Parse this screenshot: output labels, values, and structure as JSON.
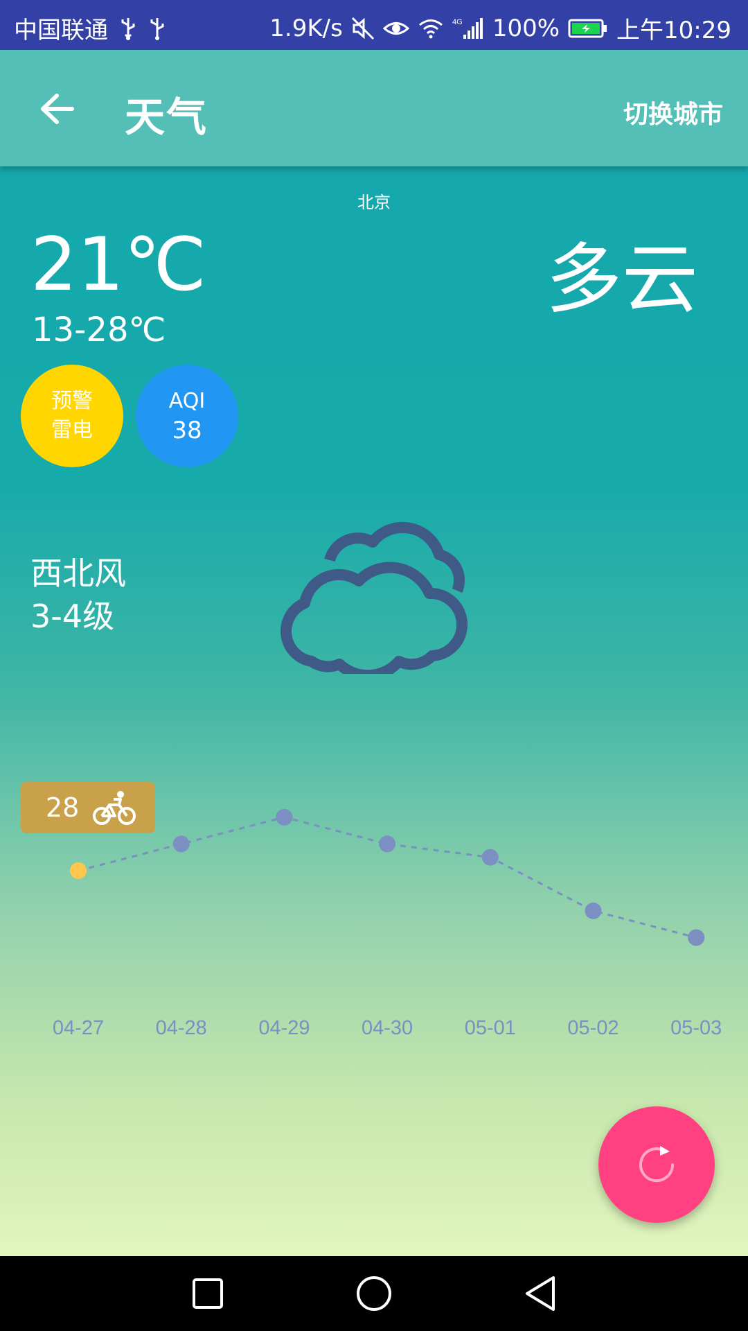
{
  "status_bar": {
    "carrier": "中国联通",
    "net_speed": "1.9K/s",
    "network_type": "4G",
    "battery": "100%",
    "time": "上午10:29",
    "icons": [
      "usb-icon",
      "usb-icon",
      "mute-icon",
      "eye-icon",
      "wifi-icon",
      "signal-icon",
      "battery-icon"
    ]
  },
  "toolbar": {
    "title": "天气",
    "action": "切换城市"
  },
  "weather": {
    "city": "北京",
    "temp_now": "21℃",
    "temp_range": "13-28℃",
    "condition": "多云",
    "warning_label": "预警",
    "warning_type": "雷电",
    "aqi_label": "AQI",
    "aqi_value": "38",
    "wind_direction": "西北风",
    "wind_level": "3-4级",
    "bike_index": "28"
  },
  "colors": {
    "status_bar": "#3340a6",
    "toolbar": "#53bfb6",
    "warning_badge": "#ffd600",
    "aqi_badge": "#2196f3",
    "bike_tag": "#c9a14a",
    "fab": "#ff4081",
    "chart_point": "#7b8fc2",
    "chart_highlight": "#ffc74d",
    "cloud": "#3f5a86"
  },
  "chart_data": {
    "type": "line",
    "categories": [
      "04-27",
      "04-28",
      "04-29",
      "04-30",
      "05-01",
      "05-02",
      "05-03"
    ],
    "series": [
      {
        "values": [
          0.0,
          0.2,
          0.4,
          0.2,
          0.1,
          -0.3,
          -0.5
        ]
      }
    ],
    "highlight_index": 0,
    "line_style": "dashed",
    "grid": false,
    "xlabel": "",
    "ylabel": ""
  },
  "fab": {
    "icon": "refresh-icon"
  },
  "nav_bar": {
    "icons": [
      "recent-apps-icon",
      "home-icon",
      "back-icon"
    ]
  }
}
